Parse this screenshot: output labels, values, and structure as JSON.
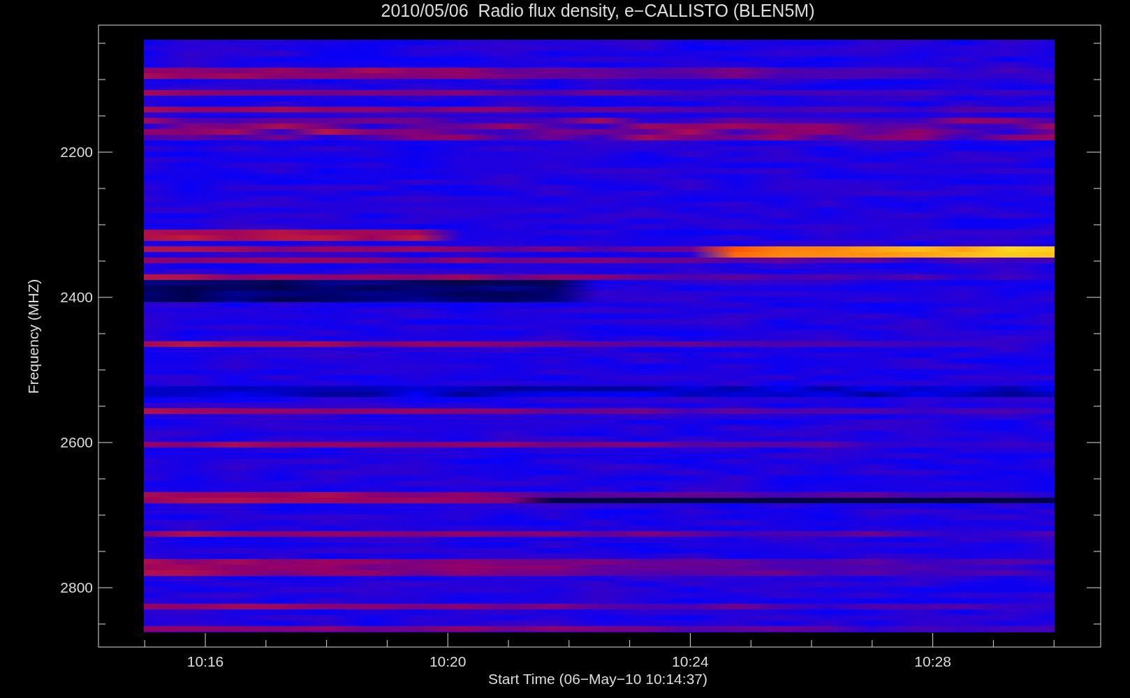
{
  "title": "2010/05/06  Radio flux density, e−CALLISTO (BLEN5M)",
  "y_axis": {
    "label": "Frequency (MHZ)",
    "ticks": [
      "2200",
      "2400",
      "2600",
      "2800"
    ]
  },
  "x_axis": {
    "label": "Start Time (06−May−10 10:14:37)",
    "ticks": [
      "10:16",
      "10:20",
      "10:24",
      "10:28"
    ]
  }
}
